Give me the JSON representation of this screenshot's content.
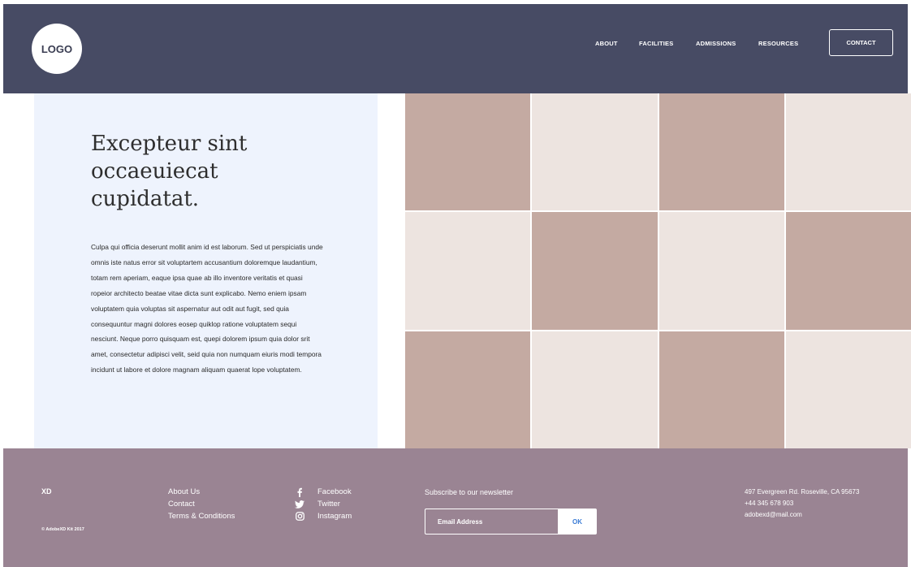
{
  "header": {
    "logo_label": "LOGO",
    "nav": [
      "ABOUT",
      "FACILITIES",
      "ADMISSIONS",
      "RESOURCES"
    ],
    "contact_label": "CONTACT"
  },
  "hero": {
    "title": "Excepteur sint occaeuiecat cupidatat.",
    "body": "Culpa qui officia deserunt mollit anim id est laborum. Sed ut perspiciatis unde omnis iste natus error sit voluptartem accusantium doloremque laudantium, totam rem aperiam, eaque ipsa quae ab illo inventore veritatis et quasi ropeior architecto beatae vitae dicta sunt explicabo. Nemo eniem ipsam voluptatem quia voluptas sit aspernatur aut odit aut fugit, sed quia consequuntur magni dolores eosep quiklop ratione voluptatem sequi nesciunt. Neque porro quisquam est, quepi dolorem ipsum quia dolor srit amet, consectetur adipisci velit, seid quia non numquam eiuris modi tempora incidunt ut labore et dolore magnam aliquam quaerat lope voluptatem."
  },
  "grid": {
    "colors": {
      "dark": "#c4aaa2",
      "light": "#ede4e0"
    },
    "pattern": [
      "dark",
      "light",
      "dark",
      "light",
      "light",
      "dark",
      "light",
      "dark",
      "dark",
      "light",
      "dark",
      "light"
    ]
  },
  "footer": {
    "brand": "XD",
    "copyright": "© AdobeXD Kit 2017",
    "links": [
      "About Us",
      "Contact",
      "Terms & Conditions"
    ],
    "social": [
      {
        "icon": "facebook-icon",
        "label": "Facebook"
      },
      {
        "icon": "twitter-icon",
        "label": "Twitter"
      },
      {
        "icon": "instagram-icon",
        "label": "Instagram"
      }
    ],
    "newsletter_title": "Subscribe to our newsletter",
    "email_placeholder": "Email Address",
    "ok_label": "OK",
    "address": "497 Evergreen Rd. Roseville, CA 95673",
    "phone": "+44 345 678 903",
    "email": "adobexd@mail.com"
  },
  "colors": {
    "header_bg": "#474b64",
    "hero_bg": "#eef3fd",
    "footer_bg": "#9a8493",
    "ok_text": "#3a7bd5"
  }
}
